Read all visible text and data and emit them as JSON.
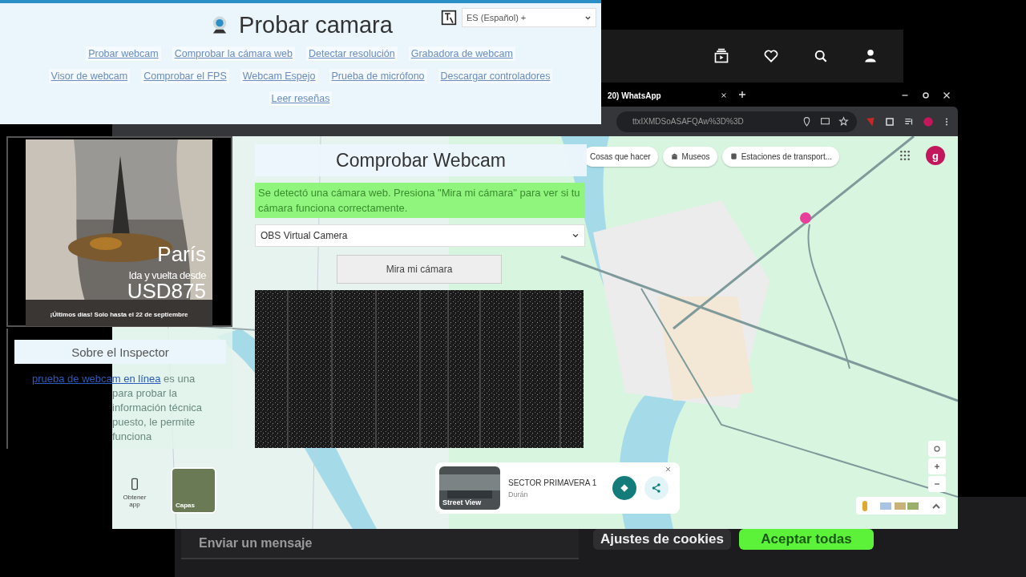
{
  "top_site": {
    "title": "Probar camara",
    "language": "ES (Español) +",
    "nav_links": [
      "Probar webcam",
      "Comprobar la cámara web",
      "Detectar resolución",
      "Grabadora de webcam",
      "Visor de webcam",
      "Comprobar el FPS",
      "Webcam Espejo",
      "Prueba de micrófono",
      "Descargar controladores",
      "Leer reseñas"
    ]
  },
  "chat_page": {
    "message_placeholder": "Enviar un mensaje",
    "cookie_buttons": [
      {
        "label": "Ajustes de cookies",
        "kind": "secondary"
      },
      {
        "label": "Aceptar todas",
        "kind": "primary"
      }
    ]
  },
  "browser": {
    "tab_title": "20) WhatsApp",
    "address": "ttxIXMDSoASAFQAw%3D%3D",
    "map": {
      "chips": [
        "Cosas que hacer",
        "Museos",
        "Estaciones de transport..."
      ],
      "account_initial": "g",
      "place_card": {
        "name": "SECTOR PRIMAVERA 1",
        "locality": "Durán",
        "street_view": "Street View"
      },
      "app_button": "Obtener app",
      "layers_button": "Capas"
    }
  },
  "webcam_tool": {
    "title": "Comprobar Webcam",
    "notice": "Se detectó una cámara web. Presiona \"Mira mi cámara\" para ver si tu cámara funciona correctamente.",
    "camera": "OBS Virtual Camera",
    "button": "Mira mi cámara"
  },
  "side_panel": {
    "ad": {
      "city": "París",
      "offer": "Ida y vuelta desde",
      "price": "USD875",
      "footer": "¡Últimos días! Solo hasta el 22 de septiembre"
    },
    "heading": "Sobre el Inspector",
    "link": "prueba de webcam en línea",
    "text_lines": [
      "es una",
      "para probar la",
      "información técnica",
      "puesto, le permite",
      "funciona"
    ]
  }
}
